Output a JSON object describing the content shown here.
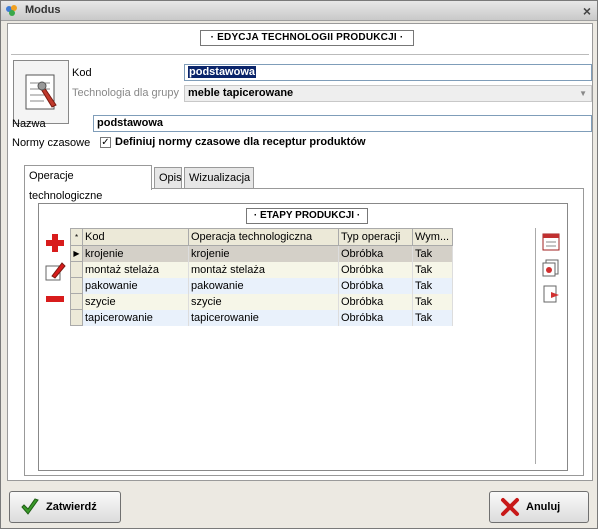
{
  "window": {
    "title": "Modus",
    "close_glyph": "×"
  },
  "header": {
    "title": "· EDYCJA TECHNOLOGII PRODUKCJI ·"
  },
  "form": {
    "kod_label": "Kod",
    "kod_value": "podstawowa",
    "tech_group_label": "Technologia dla grupy",
    "tech_group_value": "meble tapicerowane",
    "nazwa_label": "Nazwa",
    "nazwa_value": "podstawowa",
    "normy_label": "Normy czasowe",
    "normy_checkbox_label": "Definiuj normy czasowe dla receptur produktów",
    "normy_checked": true,
    "check_glyph": "✓"
  },
  "tabs": [
    {
      "label": "Operacje technologiczne",
      "active": true
    },
    {
      "label": "Opis",
      "active": false
    },
    {
      "label": "Wizualizacja",
      "active": false
    }
  ],
  "etapy": {
    "title": "· ETAPY PRODUKCJI ·",
    "columns": [
      "Kod",
      "Operacja technologiczna",
      "Typ operacji",
      "Wym..."
    ],
    "rows": [
      [
        "krojenie",
        "krojenie",
        "Obróbka",
        "Tak"
      ],
      [
        "montaż stelaża",
        "montaż stelaża",
        "Obróbka",
        "Tak"
      ],
      [
        "pakowanie",
        "pakowanie",
        "Obróbka",
        "Tak"
      ],
      [
        "szycie",
        "szycie",
        "Obróbka",
        "Tak"
      ],
      [
        "tapicerowanie",
        "tapicerowanie",
        "Obróbka",
        "Tak"
      ]
    ],
    "selected_row": 0
  },
  "footer": {
    "ok_label": "Zatwierdź",
    "cancel_label": "Anuluj"
  },
  "colors": {
    "add": "#d81c1c",
    "remove": "#d81c1c",
    "ok_check": "#3a9a2a",
    "cancel_x": "#c81818"
  }
}
